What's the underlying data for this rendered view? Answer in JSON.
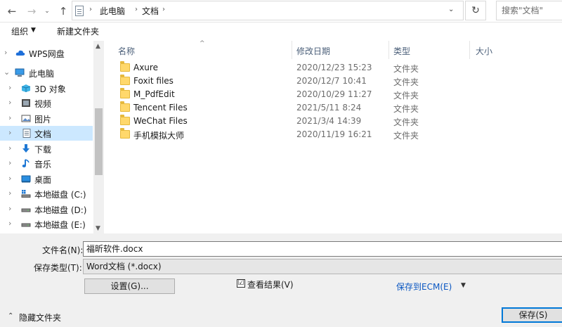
{
  "nav": {
    "back_glyph": "←",
    "forward_glyph": "→",
    "recent_glyph": "⌄",
    "up_glyph": "↑"
  },
  "address": {
    "separator": "›",
    "crumbs": [
      "此电脑",
      "文档"
    ],
    "dropdown_glyph": "⌄",
    "refresh_glyph": "↻"
  },
  "search": {
    "placeholder": "搜索\"文档\""
  },
  "toolbar": {
    "organize": "组织",
    "organize_arrow": "▼",
    "new_folder": "新建文件夹"
  },
  "tree": {
    "items": [
      {
        "label": "WPS网盘",
        "icon": "cloud-icon",
        "chevron": "›"
      },
      {
        "label": "此电脑",
        "icon": "computer-icon",
        "chevron": "⌄"
      },
      {
        "label": "3D 对象",
        "icon": "3d-objects-icon",
        "chevron": "›"
      },
      {
        "label": "视频",
        "icon": "video-icon",
        "chevron": "›"
      },
      {
        "label": "图片",
        "icon": "pictures-icon",
        "chevron": "›"
      },
      {
        "label": "文档",
        "icon": "documents-icon",
        "chevron": "›",
        "selected": true
      },
      {
        "label": "下载",
        "icon": "download-icon",
        "chevron": "›"
      },
      {
        "label": "音乐",
        "icon": "music-icon",
        "chevron": "›"
      },
      {
        "label": "桌面",
        "icon": "desktop-icon",
        "chevron": "›"
      },
      {
        "label": "本地磁盘 (C:)",
        "icon": "windows-drive-icon",
        "chevron": "›"
      },
      {
        "label": "本地磁盘 (D:)",
        "icon": "drive-icon",
        "chevron": "›"
      },
      {
        "label": "本地磁盘 (E:)",
        "icon": "drive-icon",
        "chevron": "›"
      }
    ],
    "scroll_up": "▲",
    "scroll_down": "▼"
  },
  "columns": {
    "name": "名称",
    "date": "修改日期",
    "type": "类型",
    "size": "大小",
    "sort_glyph": "^"
  },
  "files": [
    {
      "name": "Axure",
      "date": "2020/12/23 15:23",
      "type": "文件夹"
    },
    {
      "name": "Foxit files",
      "date": "2020/12/7 10:41",
      "type": "文件夹"
    },
    {
      "name": "M_PdfEdit",
      "date": "2020/10/29 11:27",
      "type": "文件夹"
    },
    {
      "name": "Tencent Files",
      "date": "2021/5/11 8:24",
      "type": "文件夹"
    },
    {
      "name": "WeChat Files",
      "date": "2021/3/4 14:39",
      "type": "文件夹"
    },
    {
      "name": "手机模拟大师",
      "date": "2020/11/19 16:21",
      "type": "文件夹"
    }
  ],
  "form": {
    "filename_label": "文件名(N):",
    "filename_value": "福昕软件.docx",
    "savetype_label": "保存类型(T):",
    "savetype_value": "Word文档 (*.docx)",
    "settings_button": "设置(G)...",
    "view_results_check": "☑",
    "view_results_label": "查看结果(V)",
    "save_ecm": "保存到ECM(E)",
    "ecm_arrow": "▼",
    "hide_folders_arrow": "⌃",
    "hide_folders": "隐藏文件夹",
    "save_button": "保存(S)"
  },
  "colors": {
    "accent": "#0078d7",
    "selection": "#cce8ff",
    "folder": "#ffd86b",
    "link": "#0b57c2"
  }
}
